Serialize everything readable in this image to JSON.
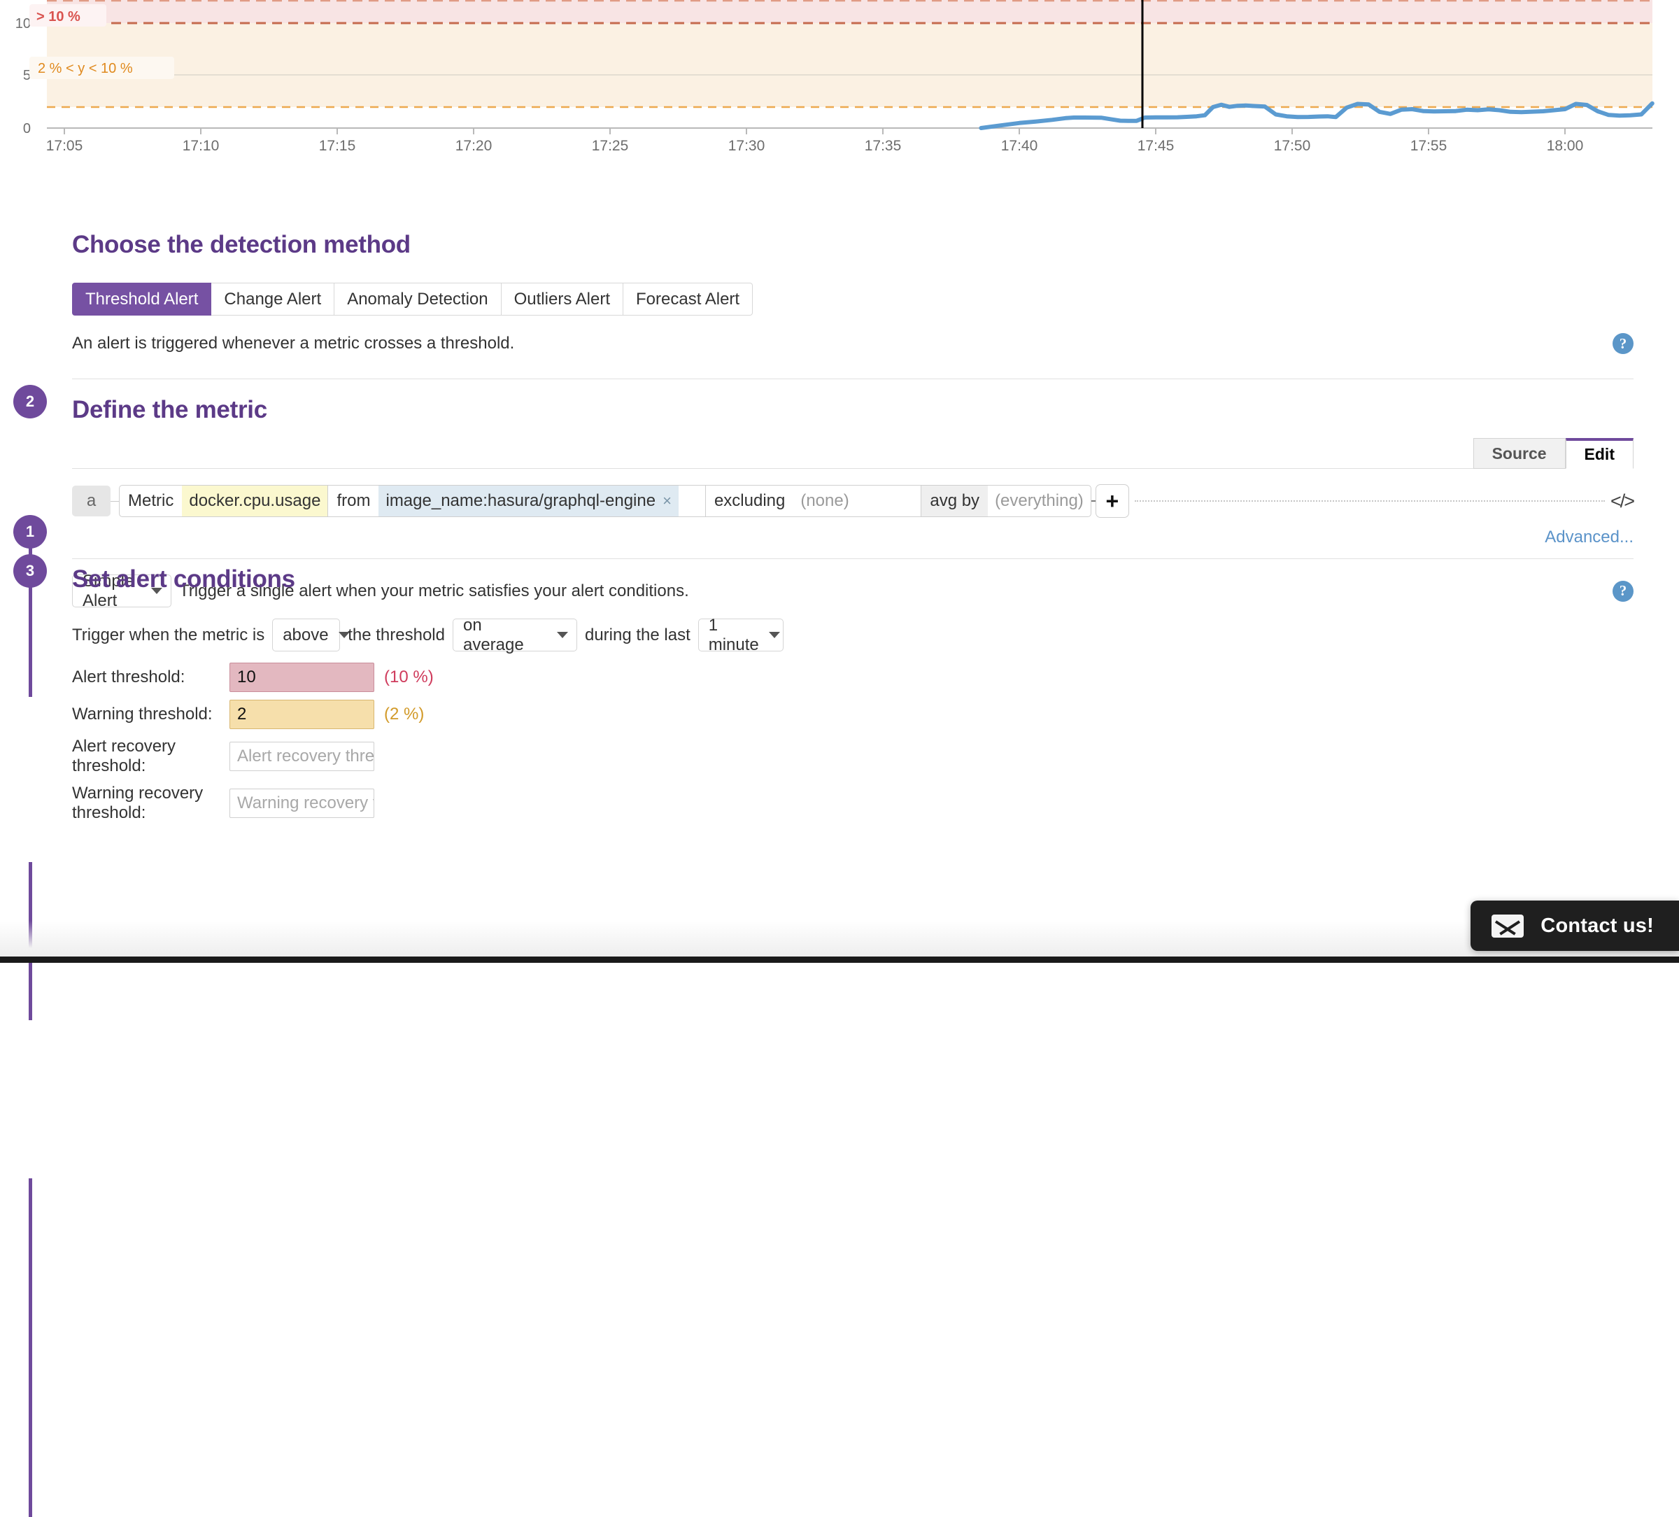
{
  "chart_data": {
    "type": "line",
    "title": "",
    "xlabel": "",
    "ylabel": "",
    "ylim": [
      0,
      12.1
    ],
    "yticks": [
      0,
      5,
      10
    ],
    "ytick_labels": [
      "0",
      "5",
      "10"
    ],
    "xtick_labels": [
      "17:05",
      "17:10",
      "17:15",
      "17:20",
      "17:25",
      "17:30",
      "17:35",
      "17:40",
      "17:45",
      "17:50",
      "17:55",
      "18:00"
    ],
    "grid": true,
    "legend": "none",
    "series": [
      {
        "name": "docker.cpu.usage",
        "color": "#5b9bd1",
        "x": [
          "17:38.6",
          "17:39.3",
          "17:40.0",
          "17:40.6",
          "17:41.2",
          "17:41.7",
          "17:42.0",
          "17:42.4",
          "17:43.0",
          "17:43.4",
          "17:43.7",
          "17:44.0",
          "17:44.3",
          "17:44.6",
          "17:45.0",
          "17:45.4",
          "17:45.8",
          "17:46.2",
          "17:46.5",
          "17:46.8",
          "17:47.1",
          "17:47.4",
          "17:47.7",
          "17:48.0",
          "17:48.3",
          "17:48.6",
          "17:49.0",
          "17:49.4",
          "17:49.8",
          "17:50.2",
          "17:50.6",
          "17:51.0",
          "17:51.3",
          "17:51.6",
          "17:52.0",
          "17:52.4",
          "17:52.8",
          "17:53.2",
          "17:53.6",
          "17:54.0",
          "17:54.4",
          "17:54.8",
          "17:55.2",
          "17:55.6",
          "17:56.0",
          "17:56.4",
          "17:56.8",
          "17:57.2",
          "17:57.6",
          "17:58.0",
          "17:58.4",
          "17:58.8",
          "17:59.2",
          "17:59.6",
          "18:00.0",
          "18:00.4",
          "18:00.8",
          "18:01.2",
          "18:01.6",
          "18:02.0",
          "18:02.4",
          "18:02.8",
          "18:03.2"
        ],
        "values": [
          0.0,
          0.25,
          0.48,
          0.62,
          0.78,
          0.95,
          1.0,
          1.0,
          0.99,
          0.82,
          0.7,
          0.68,
          0.69,
          1.0,
          1.02,
          1.02,
          1.03,
          1.07,
          1.12,
          1.22,
          2.0,
          2.22,
          2.02,
          2.12,
          2.15,
          2.1,
          2.05,
          1.3,
          1.12,
          1.05,
          1.06,
          1.1,
          1.12,
          1.05,
          1.95,
          2.3,
          2.25,
          1.55,
          1.35,
          1.75,
          1.8,
          1.62,
          1.58,
          1.6,
          1.62,
          1.75,
          1.7,
          1.78,
          1.7,
          1.55,
          1.52,
          1.56,
          1.6,
          1.7,
          1.8,
          2.3,
          2.2,
          1.6,
          1.25,
          1.18,
          1.22,
          1.3,
          2.35
        ]
      }
    ],
    "bands": [
      {
        "name": "alert-band",
        "label": "> 10 %",
        "from": 10,
        "to": 12.1,
        "fill": "#f8e4e4",
        "border": "#d9836e",
        "label_color": "#d9534f"
      },
      {
        "name": "warning-band",
        "label": "2 % < y < 10 %",
        "from": 2,
        "to": 10,
        "fill": "#fbf1e3",
        "border": "#e8a64c",
        "label_color": "#e08a1e"
      }
    ],
    "cursor": {
      "name": "crosshair",
      "x": "17:45",
      "color": "#000000"
    }
  },
  "steps": {
    "one": {
      "number": "1",
      "title": "Choose the detection method",
      "tabs": [
        {
          "label": "Threshold Alert",
          "active": true
        },
        {
          "label": "Change Alert",
          "active": false
        },
        {
          "label": "Anomaly Detection",
          "active": false
        },
        {
          "label": "Outliers Alert",
          "active": false
        },
        {
          "label": "Forecast Alert",
          "active": false
        }
      ],
      "description": "An alert is triggered whenever a metric crosses a threshold.",
      "help_icon": "question-mark-icon",
      "help_glyph": "?"
    },
    "two": {
      "number": "2",
      "title": "Define the metric",
      "mode_tabs": [
        {
          "label": "Source",
          "active": false
        },
        {
          "label": "Edit",
          "active": true
        }
      ],
      "query": {
        "letter": "a",
        "metric_label": "Metric",
        "metric_value": "docker.cpu.usage",
        "from_label": "from",
        "from_value": "image_name:hasura/graphql-engine",
        "from_remove": "×",
        "excluding_label": "excluding",
        "excluding_placeholder": "(none)",
        "avgby_label": "avg by",
        "avgby_placeholder": "(everything)",
        "add_button": "+",
        "code_icon": "code-brackets-icon",
        "code_glyph": "</>"
      },
      "advanced_link": "Advanced...",
      "alert_type": {
        "selected": "Simple Alert",
        "description": "Trigger a single alert when your metric satisfies your alert conditions."
      },
      "help_icon": "question-mark-icon",
      "help_glyph": "?"
    },
    "three": {
      "number": "3",
      "title": "Set alert conditions",
      "trigger": {
        "prefix": "Trigger when the metric is",
        "direction": "above",
        "middle": "the threshold",
        "aggregation": "on average",
        "suffix": "during the last",
        "window": "1 minute"
      },
      "thresholds": [
        {
          "name": "alert-threshold",
          "label": "Alert threshold:",
          "value": "10",
          "placeholder": "",
          "suffix": "(10 %)",
          "style": "alert"
        },
        {
          "name": "warning-threshold",
          "label": "Warning threshold:",
          "value": "2",
          "placeholder": "",
          "suffix": "(2 %)",
          "style": "warn"
        },
        {
          "name": "alert-recovery-threshold",
          "label": "Alert recovery threshold:",
          "value": "",
          "placeholder": "Alert recovery threshold (optional)",
          "suffix": "",
          "style": "empty"
        },
        {
          "name": "warning-recovery-threshold",
          "label": "Warning recovery threshold:",
          "value": "",
          "placeholder": "Warning recovery threshold (optional)",
          "suffix": "",
          "style": "empty"
        }
      ]
    }
  },
  "contact_widget": {
    "label": "Contact us!",
    "icon": "envelope-icon"
  },
  "colors": {
    "brand_purple": "#6f4a9c",
    "tab_active": "#7651a3",
    "link_blue": "#5b93c9",
    "alert_red": "#cf3b5c",
    "warning_orange": "#d29a29",
    "series_blue": "#5b9bd1"
  }
}
